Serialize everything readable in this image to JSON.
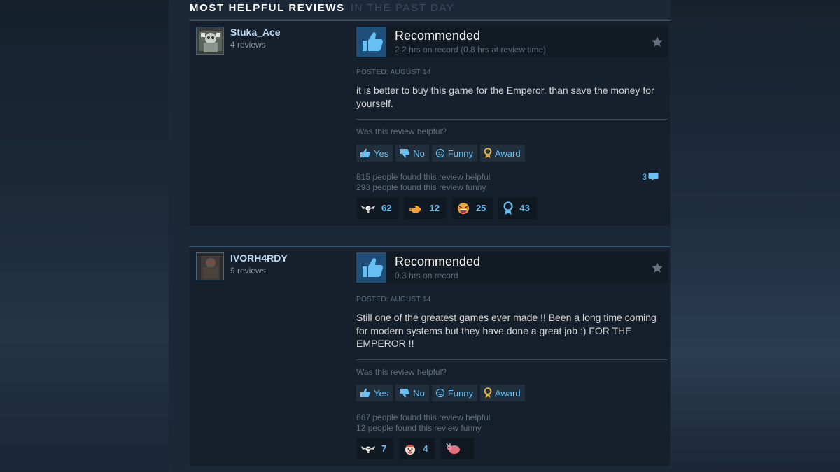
{
  "section": {
    "title": "MOST HELPFUL REVIEWS",
    "subtitle": "IN THE PAST DAY"
  },
  "colors": {
    "accent": "#67c1f5",
    "thumb_bg": "#1f4e79",
    "page_bg": "#1b2838"
  },
  "reviews": [
    {
      "author": "Stuka_Ace",
      "review_count": "4 reviews",
      "recommendation": "Recommended",
      "hours": "2.2 hrs on record (0.8 hrs at review time)",
      "posted": "POSTED: AUGUST 14",
      "text": "it is better to buy this game for the Emperor, than save the money for yourself.",
      "helpful_question": "Was this review helpful?",
      "buttons": {
        "yes": "Yes",
        "no": "No",
        "funny": "Funny",
        "award": "Award"
      },
      "helpful_count": "815 people found this review helpful",
      "funny_count": "293 people found this review funny",
      "comments": "3",
      "reactions": [
        {
          "icon": "winged-skull-icon",
          "count": "62"
        },
        {
          "icon": "pointing-hand-icon",
          "count": "12"
        },
        {
          "icon": "laughing-face-icon",
          "count": "25"
        },
        {
          "icon": "award-ribbon-icon",
          "count": "43"
        }
      ]
    },
    {
      "author": "IVORH4RDY",
      "review_count": "9 reviews",
      "recommendation": "Recommended",
      "hours": "0.3 hrs on record",
      "posted": "POSTED: AUGUST 14",
      "text": "Still one of the greatest games ever made !! Been a long time coming for modern systems but they have done a great job :) FOR THE EMPEROR !!",
      "helpful_question": "Was this review helpful?",
      "buttons": {
        "yes": "Yes",
        "no": "No",
        "funny": "Funny",
        "award": "Award"
      },
      "helpful_count": "667 people found this review helpful",
      "funny_count": "12 people found this review funny",
      "reactions": [
        {
          "icon": "winged-skull-icon",
          "count": "7"
        },
        {
          "icon": "clown-face-icon",
          "count": "4"
        },
        {
          "icon": "pink-creature-icon",
          "count": ""
        }
      ]
    }
  ]
}
